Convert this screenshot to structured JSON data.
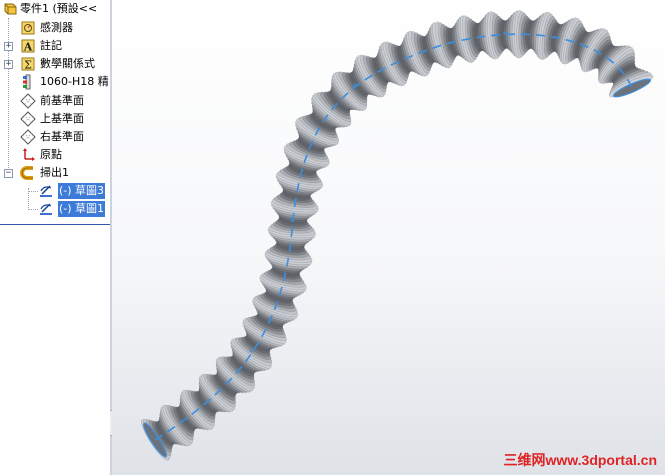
{
  "feature_tree": {
    "part": {
      "label": "零件1 (預設<<",
      "icon": "part-icon"
    },
    "items": [
      {
        "label": "感測器",
        "icon": "sensor-icon"
      },
      {
        "label": "註記",
        "icon": "annotation-icon"
      },
      {
        "label": "數學關係式",
        "icon": "equation-icon"
      },
      {
        "label": "1060-H18 精",
        "icon": "material-icon"
      },
      {
        "label": "前基準面",
        "icon": "plane-icon"
      },
      {
        "label": "上基準面",
        "icon": "plane-icon"
      },
      {
        "label": "右基準面",
        "icon": "plane-icon"
      },
      {
        "label": "原點",
        "icon": "origin-icon"
      },
      {
        "label": "掃出1",
        "icon": "sweep-icon"
      },
      {
        "label": "(-) 草圖3",
        "icon": "sketch-icon"
      },
      {
        "label": "(-) 草圖1",
        "icon": "sketch-icon"
      }
    ]
  },
  "colors": {
    "selection": "#3d7bd8",
    "tube_base": "#b8bcc2",
    "path_line": "#3b8fe0",
    "watermark": "#e02222"
  },
  "splitter_arrows": "«««",
  "watermark": "三维网www.3dportal.cn"
}
